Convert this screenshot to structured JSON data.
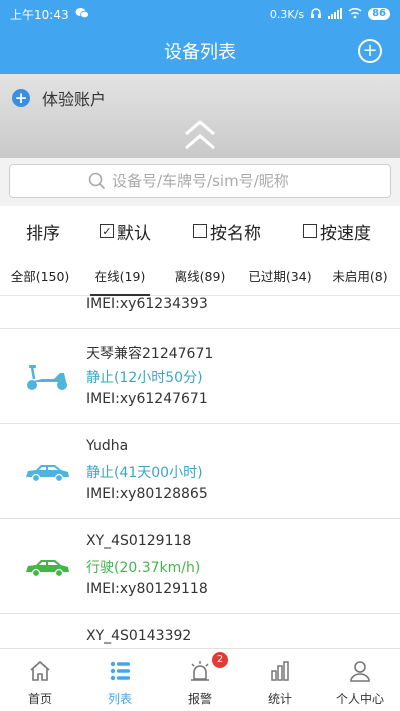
{
  "status_bar": {
    "time": "上午10:43",
    "net_speed": "0.3K/s",
    "battery": "86"
  },
  "header": {
    "title": "设备列表"
  },
  "account": {
    "name": "体验账户"
  },
  "search": {
    "placeholder": "设备号/车牌号/sim号/昵称"
  },
  "sort": {
    "label": "排序",
    "options": [
      {
        "label": "默认",
        "checked": true
      },
      {
        "label": "按名称",
        "checked": false
      },
      {
        "label": "按速度",
        "checked": false
      }
    ]
  },
  "tabs": [
    {
      "label": "全部(150)"
    },
    {
      "label": "在线(19)"
    },
    {
      "label": "离线(89)"
    },
    {
      "label": "已过期(34)"
    },
    {
      "label": "未启用(8)"
    }
  ],
  "devices": [
    {
      "name": "",
      "status": "",
      "imei": "IMEI:xy61234393",
      "type": "partial"
    },
    {
      "name": "天琴兼容21247671",
      "status": "静止(12小时50分)",
      "imei": "IMEI:xy61247671",
      "type": "scooter"
    },
    {
      "name": "Yudha",
      "status": "静止(41天00小时)",
      "imei": "IMEI:xy80128865",
      "type": "car"
    },
    {
      "name": "XY_4S0129118",
      "status": "行驶(20.37km/h)",
      "imei": "IMEI:xy80129118",
      "type": "car-moving"
    },
    {
      "name": "XY_4S0143392",
      "status": "",
      "imei": "",
      "type": "partial-bottom"
    }
  ],
  "bottom_nav": {
    "items": [
      {
        "label": "首页"
      },
      {
        "label": "列表"
      },
      {
        "label": "报警",
        "badge": "2"
      },
      {
        "label": "统计"
      },
      {
        "label": "个人中心"
      }
    ]
  },
  "colors": {
    "primary": "#42a5f0",
    "static_status": "#3aa6c9",
    "moving_status": "#43b649",
    "badge": "#e53935"
  }
}
